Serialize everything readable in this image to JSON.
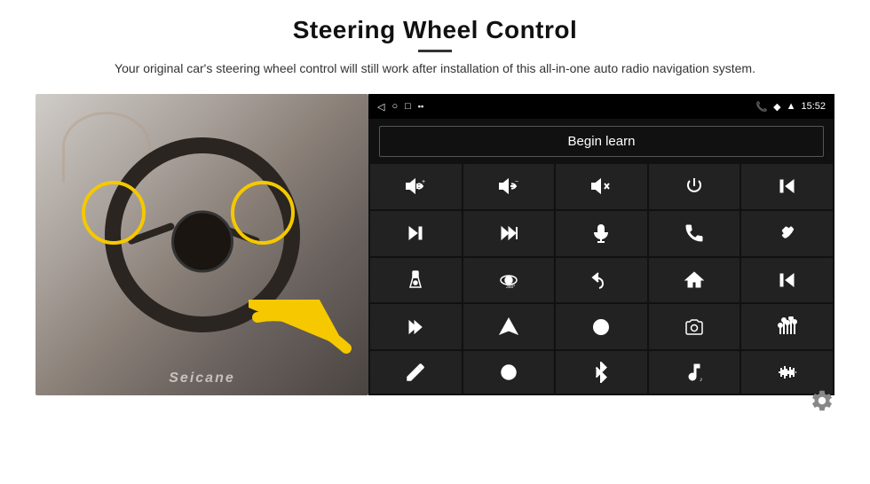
{
  "header": {
    "title": "Steering Wheel Control",
    "divider": true,
    "subtitle": "Your original car's steering wheel control will still work after installation of this all-in-one auto radio navigation system."
  },
  "panel": {
    "status_bar": {
      "back_icon": "◁",
      "circle_icon": "○",
      "square_icon": "□",
      "signal_icon": "▪▪",
      "phone_icon": "📞",
      "wifi_icon": "◆",
      "signal_bars": "▲",
      "time": "15:52"
    },
    "begin_learn_label": "Begin learn",
    "grid_icons": [
      {
        "id": "vol-up",
        "symbol": "vol+"
      },
      {
        "id": "vol-down",
        "symbol": "vol−"
      },
      {
        "id": "vol-mute",
        "symbol": "vol×"
      },
      {
        "id": "power",
        "symbol": "power"
      },
      {
        "id": "prev-track",
        "symbol": "prev"
      },
      {
        "id": "next",
        "symbol": "next"
      },
      {
        "id": "next-prev",
        "symbol": "next-prev"
      },
      {
        "id": "mic",
        "symbol": "mic"
      },
      {
        "id": "phone",
        "symbol": "phone"
      },
      {
        "id": "hang-up",
        "symbol": "hangup"
      },
      {
        "id": "flashlight",
        "symbol": "flash"
      },
      {
        "id": "360-cam",
        "symbol": "360"
      },
      {
        "id": "back",
        "symbol": "back"
      },
      {
        "id": "home",
        "symbol": "home"
      },
      {
        "id": "skip-back",
        "symbol": "skip-back"
      },
      {
        "id": "fast-forward",
        "symbol": "ff"
      },
      {
        "id": "navigation",
        "symbol": "nav"
      },
      {
        "id": "swap",
        "symbol": "swap"
      },
      {
        "id": "camera",
        "symbol": "camera"
      },
      {
        "id": "equalizer",
        "symbol": "eq"
      },
      {
        "id": "pen",
        "symbol": "pen"
      },
      {
        "id": "record",
        "symbol": "record"
      },
      {
        "id": "bluetooth",
        "symbol": "bt"
      },
      {
        "id": "music",
        "symbol": "music"
      },
      {
        "id": "waveform",
        "symbol": "wave"
      }
    ]
  },
  "branding": {
    "text": "Seicane"
  }
}
